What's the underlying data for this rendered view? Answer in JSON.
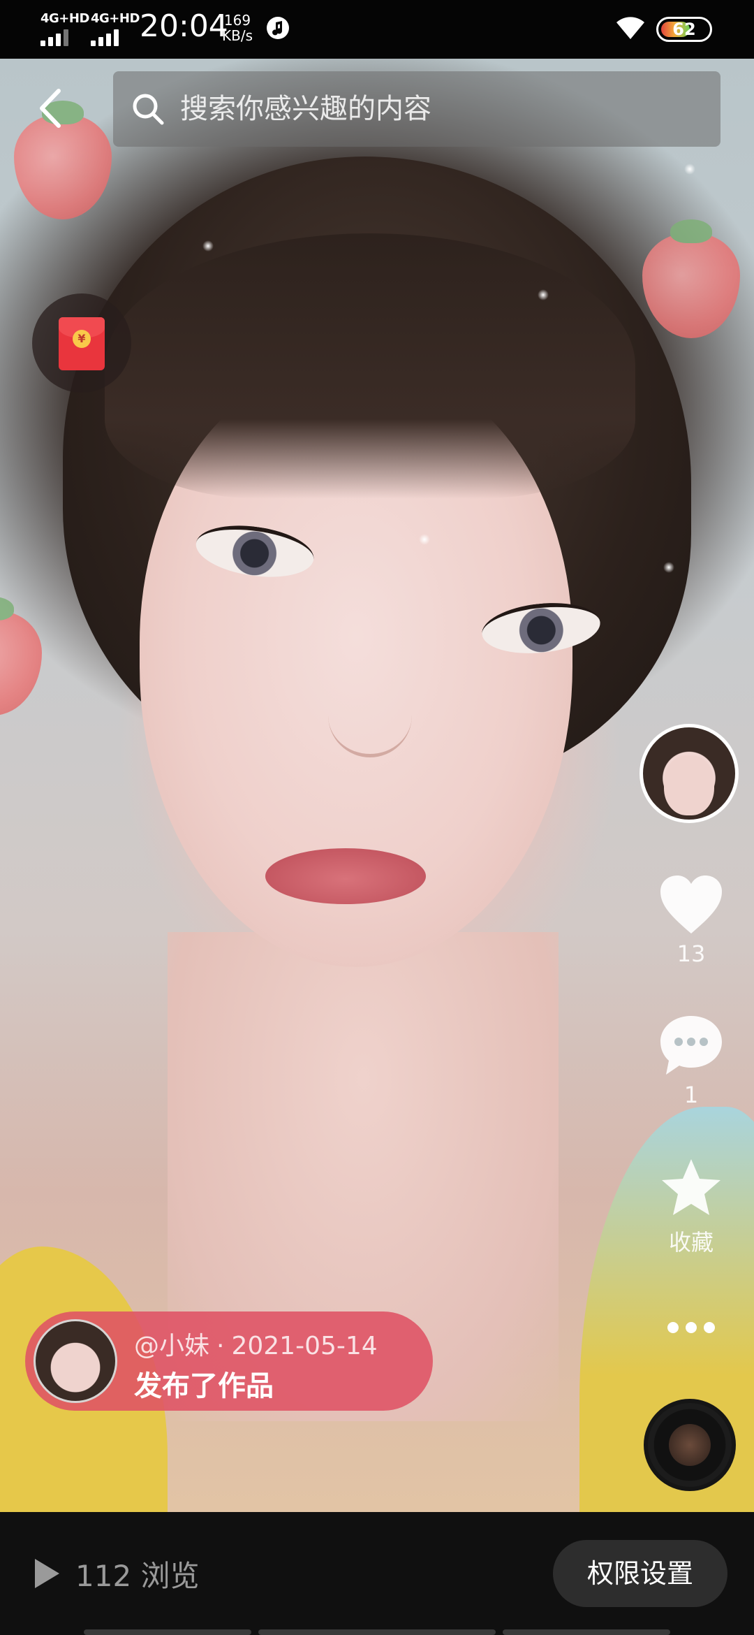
{
  "status_bar": {
    "sim1": "4G+HD",
    "sim2": "4G+HD",
    "time": "20:04",
    "net_speed_value": "169",
    "net_speed_unit": "KB/s",
    "battery_level": "62",
    "icons": [
      "signal-icon",
      "music-icon",
      "wifi-icon",
      "battery-icon"
    ]
  },
  "search": {
    "placeholder": "搜索你感兴趣的内容"
  },
  "rail": {
    "like_count": "13",
    "comment_count": "1",
    "favorite_label": "收藏"
  },
  "post": {
    "author": "@小妹",
    "separator": "·",
    "date": "2021-05-14",
    "action": "发布了作品"
  },
  "bottom": {
    "views": "112 浏览",
    "permission_button": "权限设置"
  },
  "colors": {
    "pill": "#df5264",
    "bottom_bar": "#101010",
    "button": "#2d2d2d"
  }
}
